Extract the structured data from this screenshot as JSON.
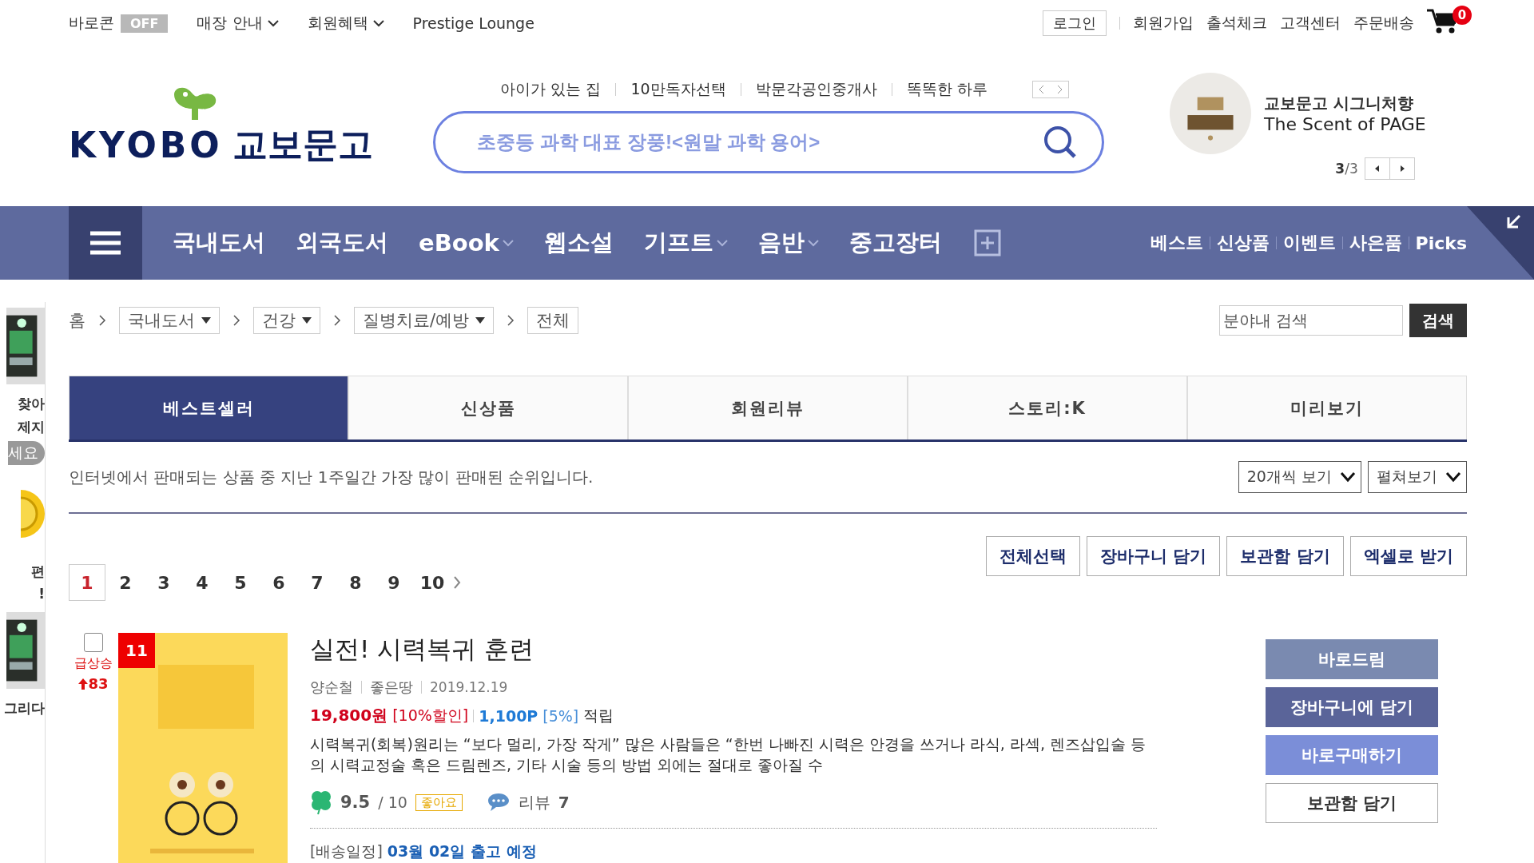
{
  "top_bar": {
    "barocon": {
      "label": "바로콘",
      "state": "OFF"
    },
    "menus": [
      {
        "label": "매장 안내",
        "dropdown": true
      },
      {
        "label": "회원혜택",
        "dropdown": true
      },
      {
        "label": "Prestige Lounge",
        "dropdown": false
      }
    ],
    "login": "로그인",
    "links": [
      "회원가입",
      "출석체크",
      "고객센터",
      "주문배송"
    ],
    "cart_count": "0"
  },
  "header": {
    "logo": {
      "latin": "KYOBO",
      "korean": "교보문고"
    },
    "quick_links": [
      "아이가 있는 집",
      "10만독자선택",
      "박문각공인중개사",
      "똑똑한 하루"
    ],
    "search": {
      "placeholder": "초중등 과학 대표 장풍!<원말 과학 용어>"
    },
    "promo": {
      "title": "교보문고 시그니처향",
      "subtitle": "The Scent of PAGE",
      "page": "3",
      "total": "/3"
    }
  },
  "nav": {
    "items": [
      {
        "label": "국내도서",
        "dropdown": false
      },
      {
        "label": "외국도서",
        "dropdown": false
      },
      {
        "label": "eBook",
        "dropdown": true
      },
      {
        "label": "웹소설",
        "dropdown": false
      },
      {
        "label": "기프트",
        "dropdown": true
      },
      {
        "label": "음반",
        "dropdown": true
      },
      {
        "label": "중고장터",
        "dropdown": false
      }
    ],
    "right_links": [
      "베스트",
      "신상품",
      "이벤트",
      "사은품",
      "Picks"
    ]
  },
  "side_strip": [
    {
      "kind": "picture"
    },
    {
      "kind": "text",
      "text": "찾아"
    },
    {
      "kind": "text",
      "text": "제지"
    },
    {
      "kind": "pill",
      "text": "세요"
    },
    {
      "kind": "coin"
    },
    {
      "kind": "text",
      "text": "편"
    },
    {
      "kind": "text",
      "text": "!"
    },
    {
      "kind": "picture"
    },
    {
      "kind": "text",
      "text": "그리다"
    }
  ],
  "breadcrumb": {
    "home": "홈",
    "crumbs": [
      {
        "label": "국내도서",
        "dropdown": true
      },
      {
        "label": "건강",
        "dropdown": true
      },
      {
        "label": "질병치료/예방",
        "dropdown": true
      },
      {
        "label": "전체",
        "dropdown": false
      }
    ]
  },
  "category_search": {
    "placeholder": "분야내 검색",
    "button": "검색"
  },
  "tabs": [
    {
      "label": "베스트셀러",
      "selected": true
    },
    {
      "label": "신상품",
      "selected": false
    },
    {
      "label": "회원리뷰",
      "selected": false
    },
    {
      "label": "스토리:K",
      "selected": false
    },
    {
      "label": "미리보기",
      "selected": false
    }
  ],
  "description": "인터넷에서 판매되는 상품 중 지난 1주일간 가장 많이 판매된 순위입니다.",
  "view_selects": [
    "20개씩 보기",
    "펼쳐보기"
  ],
  "actions": [
    "전체선택",
    "장바구니 담기",
    "보관함 담기",
    "엑셀로 받기"
  ],
  "pagination": [
    {
      "label": "1",
      "selected": true
    },
    {
      "label": "2",
      "selected": false
    },
    {
      "label": "3",
      "selected": false
    },
    {
      "label": "4",
      "selected": false
    },
    {
      "label": "5",
      "selected": false
    },
    {
      "label": "6",
      "selected": false
    },
    {
      "label": "7",
      "selected": false
    },
    {
      "label": "8",
      "selected": false
    },
    {
      "label": "9",
      "selected": false
    },
    {
      "label": "10",
      "selected": false
    }
  ],
  "book": {
    "checked": false,
    "rank": "11",
    "trend": "급상승",
    "change": "83",
    "title": "실전! 시력복귀 훈련",
    "author": "양순철",
    "publisher": "좋은땅",
    "date": "2019.12.19",
    "price": "19,800원",
    "discount": "[10%할인]",
    "points": "1,100P",
    "points_rate": "[5%]",
    "points_label": "적립",
    "summary": "시력복귀(회복)원리는 “보다 멀리, 가장 작게” 많은 사람들은 “한번 나빠진 시력은 안경을 쓰거나 라식, 라섹, 렌즈삽입술 등의 시력교정술 혹은 드림렌즈, 기타 시술 등의 방법 외에는 절대로 좋아질 수",
    "rating": "9.5",
    "rating_max": "/ 10",
    "rating_tag": "좋아요",
    "review_label": "리뷰",
    "review_count": "7",
    "shipping_label": "[배송일정]",
    "shipping_value": "03월 02일 출고 예정",
    "buttons": [
      {
        "label": "바로드림",
        "kind": "muted"
      },
      {
        "label": "장바구니에 담기",
        "kind": "dark"
      },
      {
        "label": "바로구매하기",
        "kind": "bright"
      },
      {
        "label": "보관함 담기",
        "kind": "outline"
      }
    ]
  }
}
